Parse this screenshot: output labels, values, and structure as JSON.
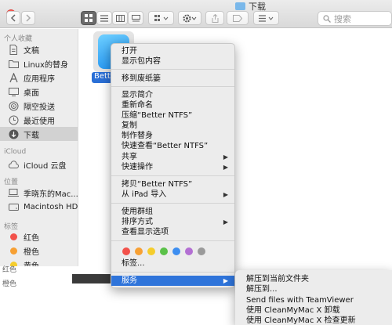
{
  "window": {
    "title": "下载"
  },
  "search": {
    "placeholder": "搜索"
  },
  "sidebar": {
    "favorites_header": "个人收藏",
    "favorites": [
      {
        "label": "文稿",
        "icon": "document-icon"
      },
      {
        "label": "Linux的替身",
        "icon": "folder-icon"
      },
      {
        "label": "应用程序",
        "icon": "applications-icon"
      },
      {
        "label": "桌面",
        "icon": "desktop-icon"
      },
      {
        "label": "隔空投送",
        "icon": "airdrop-icon"
      },
      {
        "label": "最近使用",
        "icon": "clock-icon"
      },
      {
        "label": "下载",
        "icon": "download-icon"
      }
    ],
    "icloud_header": "iCloud",
    "icloud": [
      {
        "label": "iCloud 云盘",
        "icon": "cloud-icon"
      }
    ],
    "locations_header": "位置",
    "locations": [
      {
        "label": "季晓东的Mac...",
        "icon": "laptop-icon"
      },
      {
        "label": "Macintosh HD",
        "icon": "harddisk-icon"
      }
    ],
    "tags_header": "标签",
    "tags": [
      {
        "label": "红色",
        "color": "#f2514a"
      },
      {
        "label": "橙色",
        "color": "#f7a033"
      },
      {
        "label": "黄色",
        "color": "#f5cd2c"
      }
    ]
  },
  "main": {
    "selected_item_label": "Better NTFS"
  },
  "bottom": {
    "label1": "红色",
    "label2": "橙色"
  },
  "context_menu": {
    "items": [
      {
        "label": "打开"
      },
      {
        "label": "显示包内容"
      },
      {
        "label": "移到废纸篓"
      },
      {
        "label": "显示简介"
      },
      {
        "label": "重新命名"
      },
      {
        "label": "压缩“Better NTFS”"
      },
      {
        "label": "复制"
      },
      {
        "label": "制作替身"
      },
      {
        "label": "快速查看“Better NTFS”"
      },
      {
        "label": "共享"
      },
      {
        "label": "快速操作"
      },
      {
        "label": "拷贝“Better NTFS”"
      },
      {
        "label": "从 iPad 导入"
      },
      {
        "label": "使用群组"
      },
      {
        "label": "排序方式"
      },
      {
        "label": "查看显示选项"
      },
      {
        "label": "标签..."
      },
      {
        "label": "服务"
      }
    ],
    "tag_colors": [
      "#f2514a",
      "#f7a033",
      "#f5cd2c",
      "#5ac148",
      "#3d8ef0",
      "#b36fd3",
      "#9a9a9a"
    ]
  },
  "submenu": {
    "items": [
      {
        "label": "解压到当前文件夹"
      },
      {
        "label": "解压到..."
      },
      {
        "label": "Send files with TeamViewer"
      },
      {
        "label": "使用 CleanMyMac X 卸载"
      },
      {
        "label": "使用 CleanMyMac X 检查更新"
      }
    ]
  }
}
